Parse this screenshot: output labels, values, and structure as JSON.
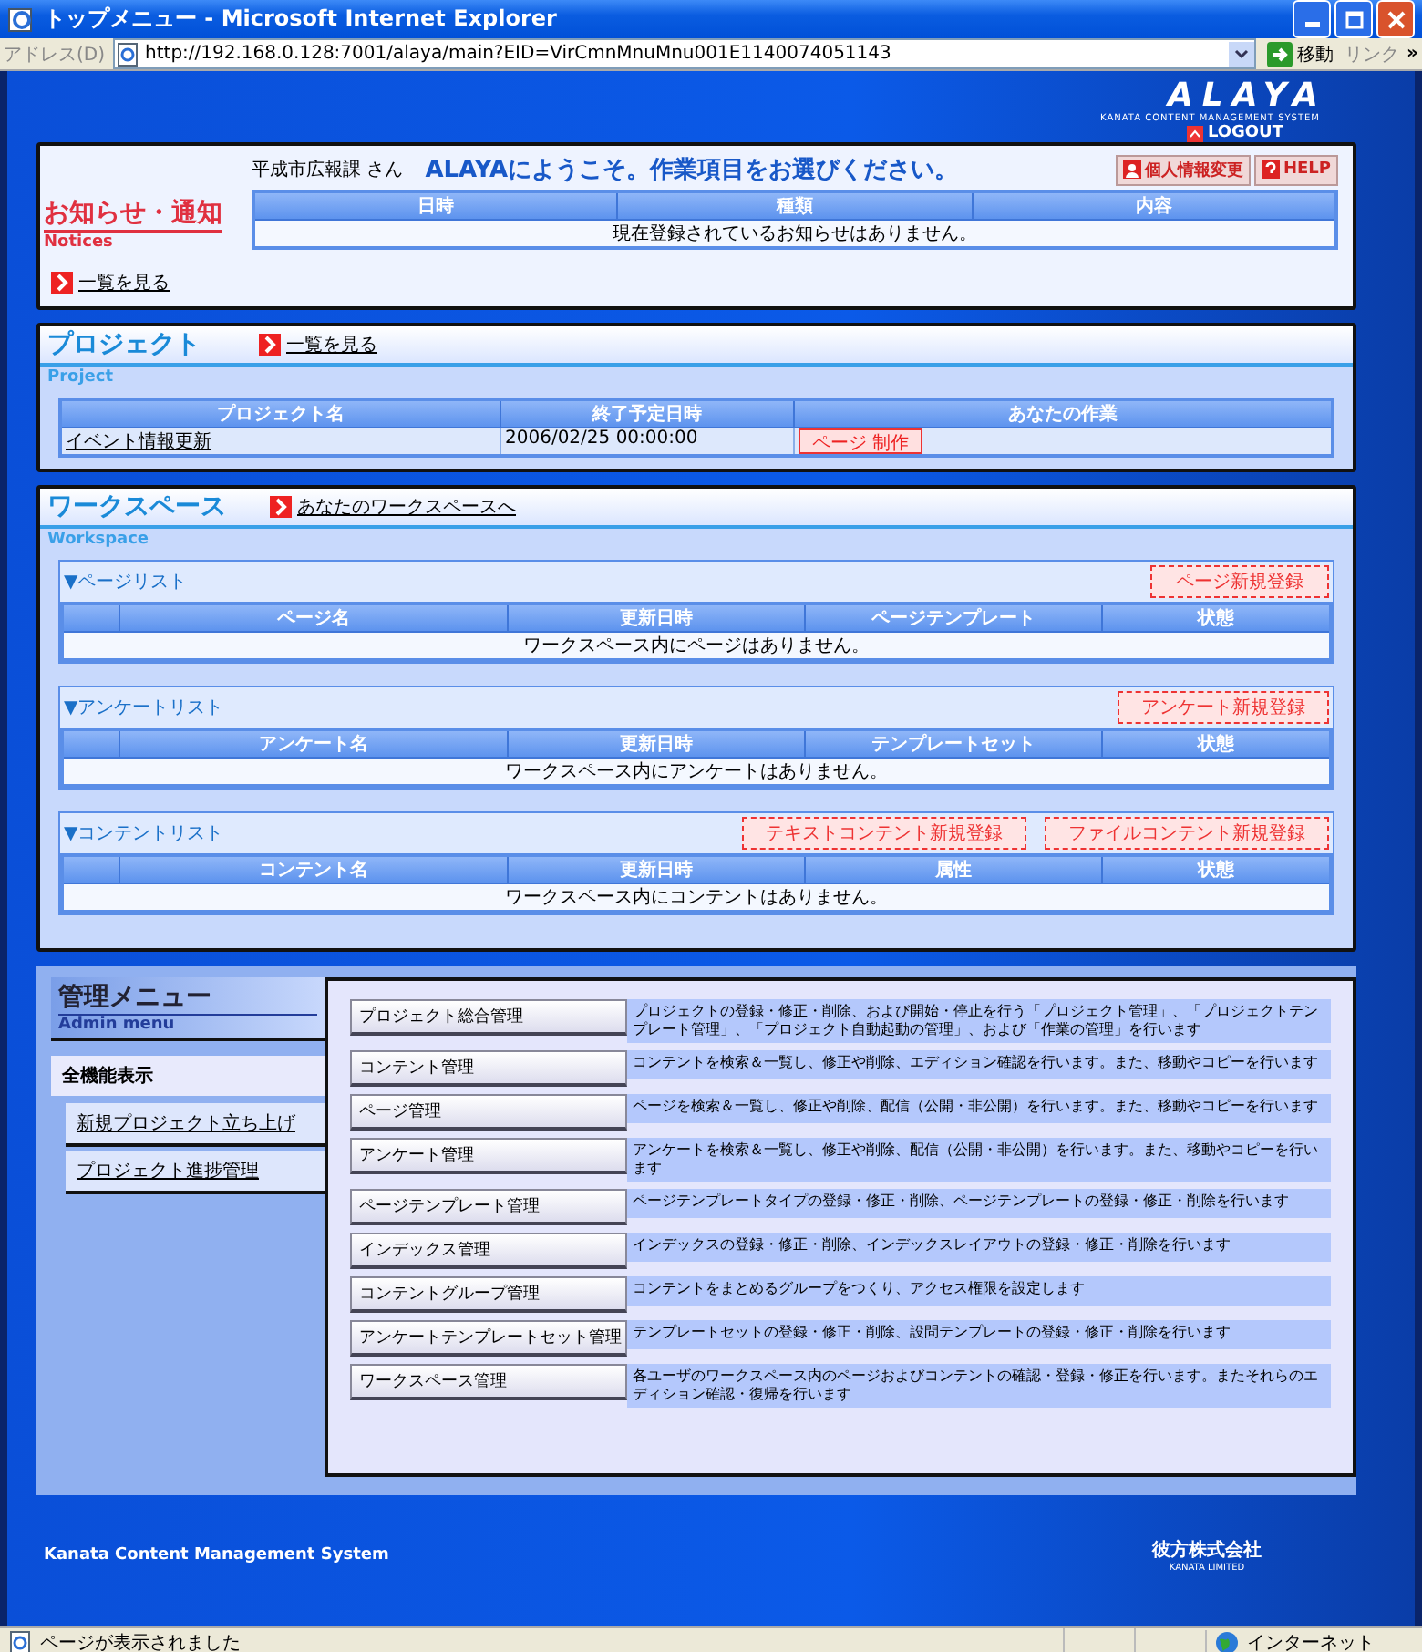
{
  "window": {
    "title": "トップメニュー - Microsoft Internet Explorer"
  },
  "address_bar": {
    "label": "アドレス(D)",
    "url": "http://192.168.0.128:7001/alaya/main?EID=VirCmnMnuMnu001E1140074051143",
    "go": "移動",
    "links": "リンク",
    "more": "»"
  },
  "header": {
    "logo": "ALAYA",
    "logo_sub": "KANATA CONTENT MANAGEMENT SYSTEM",
    "logout": "LOGOUT",
    "user": "平成市広報課 さん",
    "welcome": "ALAYAにようこそ。作業項目をお選びください。",
    "buttons": [
      {
        "kind": "profile",
        "label": "個人情報変更"
      },
      {
        "kind": "help",
        "label": "HELP"
      }
    ]
  },
  "notices": {
    "title": "お知らせ・通知",
    "subtitle": "Notices",
    "columns": [
      "日時",
      "種類",
      "内容"
    ],
    "empty": "現在登録されているお知らせはありません。",
    "link": "一覧を見る"
  },
  "project": {
    "title": "プロジェクト",
    "subtitle": "Project",
    "link": "一覧を見る",
    "columns": [
      "プロジェクト名",
      "終了予定日時",
      "あなたの作業"
    ],
    "rows": [
      {
        "name": "イベント情報更新",
        "date": "2006/02/25 00:00:00",
        "task": "ページ 制作"
      }
    ]
  },
  "workspace": {
    "title": "ワークスペース",
    "subtitle": "Workspace",
    "link": "あなたのワークスペースへ",
    "lists": [
      {
        "title": "▼ページリスト",
        "buttons": [
          "ページ新規登録"
        ],
        "columns": [
          "ページ名",
          "更新日時",
          "ページテンプレート",
          "状態"
        ],
        "empty": "ワークスペース内にページはありません。"
      },
      {
        "title": "▼アンケートリスト",
        "buttons": [
          "アンケート新規登録"
        ],
        "columns": [
          "アンケート名",
          "更新日時",
          "テンプレートセット",
          "状態"
        ],
        "empty": "ワークスペース内にアンケートはありません。"
      },
      {
        "title": "▼コンテントリスト",
        "buttons": [
          "テキストコンテント新規登録",
          "ファイルコンテント新規登録"
        ],
        "columns": [
          "コンテント名",
          "更新日時",
          "属性",
          "状態"
        ],
        "empty": "ワークスペース内にコンテントはありません。"
      }
    ]
  },
  "admin": {
    "title": "管理メニュー",
    "subtitle": "Admin menu",
    "tabs": [
      {
        "label": "全機能表示",
        "selected": true
      },
      {
        "label": "新規プロジェクト立ち上げ",
        "selected": false
      },
      {
        "label": "プロジェクト進捗管理",
        "selected": false
      }
    ],
    "items": [
      {
        "label": "プロジェクト総合管理",
        "description": "プロジェクトの登録・修正・削除、および開始・停止を行う「プロジェクト管理」、「プロジェクトテンプレート管理」、「プロジェクト自動起動の管理」、および「作業の管理」を行います"
      },
      {
        "label": "コンテント管理",
        "description": "コンテントを検索＆一覧し、修正や削除、エディション確認を行います。また、移動やコピーを行います"
      },
      {
        "label": "ページ管理",
        "description": "ページを検索＆一覧し、修正や削除、配信（公開・非公開）を行います。また、移動やコピーを行います"
      },
      {
        "label": "アンケート管理",
        "description": "アンケートを検索＆一覧し、修正や削除、配信（公開・非公開）を行います。また、移動やコピーを行います"
      },
      {
        "label": "ページテンプレート管理",
        "description": "ページテンプレートタイプの登録・修正・削除、ページテンプレートの登録・修正・削除を行います"
      },
      {
        "label": "インデックス管理",
        "description": "インデックスの登録・修正・削除、インデックスレイアウトの登録・修正・削除を行います"
      },
      {
        "label": "コンテントグループ管理",
        "description": "コンテントをまとめるグループをつくり、アクセス権限を設定します"
      },
      {
        "label": "アンケートテンプレートセット管理",
        "description": "テンプレートセットの登録・修正・削除、設問テンプレートの登録・修正・削除を行います"
      },
      {
        "label": "ワークスペース管理",
        "description": "各ユーザのワークスペース内のページおよびコンテントの確認・登録・修正を行います。またそれらのエディション確認・復帰を行います"
      }
    ]
  },
  "footer": {
    "text": "Kanata Content Management System",
    "company": "彼方株式会社",
    "company_sub": "KANATA LIMITED"
  },
  "status_bar": {
    "text": "ページが表示されました",
    "zone": "インターネット"
  }
}
